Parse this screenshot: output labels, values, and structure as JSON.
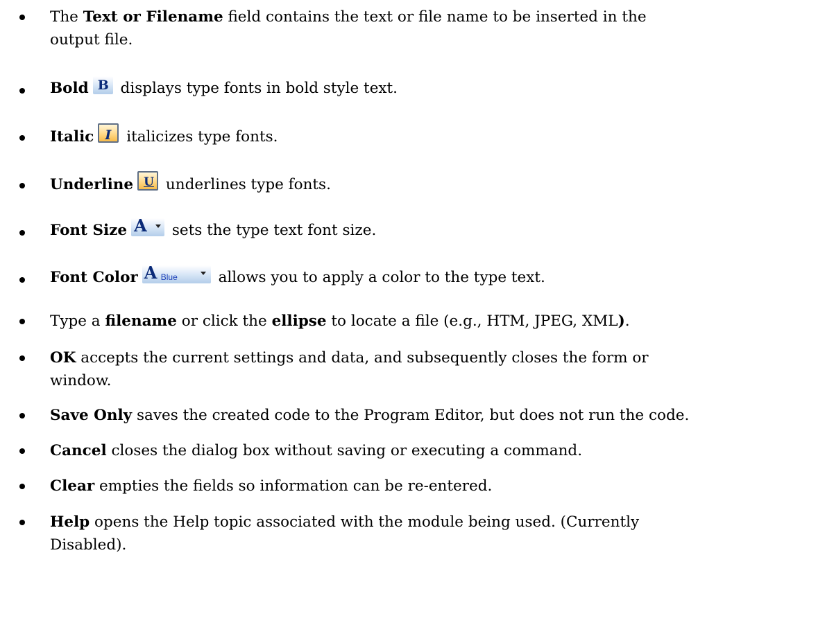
{
  "items": [
    {
      "term": "Text or Filename",
      "pre": "The ",
      "post": " field contains the text or file name to be inserted in the",
      "line2": "output file."
    },
    {
      "term": "Bold",
      "icon_glyph": "B",
      "icon_name": "bold-icon",
      "post": " displays type fonts in bold style text."
    },
    {
      "term": "Italic",
      "icon_glyph": "I",
      "icon_name": "italic-icon",
      "post": " italicizes type fonts."
    },
    {
      "term": "Underline",
      "icon_glyph": "U",
      "icon_name": "underline-icon",
      "post": " underlines type fonts."
    },
    {
      "term": "Font Size",
      "icon_glyph": "A",
      "icon_name": "font-size-icon",
      "post": " sets the type text font size."
    },
    {
      "term": "Font Color",
      "icon_glyph": "A",
      "icon_label": "Blue",
      "icon_name": "font-color-icon",
      "post": " allows you to apply a color to the type text."
    },
    {
      "pre": "Type a ",
      "term": "filename",
      "mid": " or click the ",
      "term2": "ellipse",
      "post": " to locate a file (e.g., HTM, JPEG, XML",
      "closing": ")",
      "end": "."
    },
    {
      "term": "OK",
      "post": " accepts the current settings and data, and subsequently closes the form or",
      "line2": "window."
    },
    {
      "term": "Save Only",
      "post": " saves the created code to the Program Editor, but does not run the code."
    },
    {
      "term": "Cancel",
      "post": " closes the dialog box without saving or executing a command."
    },
    {
      "term": "Clear",
      "post": " empties the fields so information can be re-entered."
    },
    {
      "term": "Help",
      "post": " opens the Help topic associated with the module being used. (Currently",
      "line2": "Disabled)."
    }
  ]
}
